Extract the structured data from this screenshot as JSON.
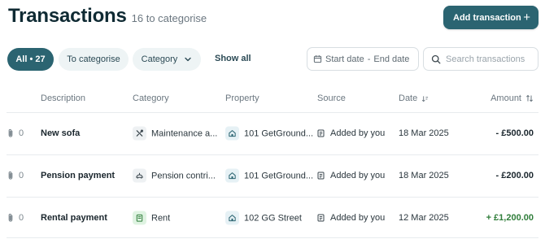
{
  "header": {
    "title": "Transactions",
    "subtitle": "16 to categorise",
    "add_button": "Add transaction"
  },
  "filters": {
    "all": "All • 27",
    "to_categorise": "To categorise",
    "category": "Category",
    "show_all": "Show all",
    "date_start": "Start date",
    "date_end": "End date",
    "search_placeholder": "Search transactions"
  },
  "columns": {
    "description": "Description",
    "category": "Category",
    "property": "Property",
    "source": "Source",
    "date": "Date",
    "amount": "Amount"
  },
  "rows": [
    {
      "attachments": "0",
      "description": "New sofa",
      "category": "Maintenance a...",
      "category_icon": "tools-icon",
      "property": "101 GetGround...",
      "source": "Added by you",
      "date": "18 Mar 2025",
      "amount": "- £500.00"
    },
    {
      "attachments": "0",
      "description": "Pension payment",
      "category": "Pension contri...",
      "category_icon": "piggy-bank-icon",
      "property": "101 GetGround...",
      "source": "Added by you",
      "date": "18 Mar 2025",
      "amount": "- £200.00"
    },
    {
      "attachments": "0",
      "description": "Rental payment",
      "category": "Rent",
      "category_icon": "rent-icon",
      "property": "102 GG Street",
      "source": "Added by you",
      "date": "12 Mar 2025",
      "amount": "+ £1,200.00"
    }
  ],
  "colors": {
    "primary": "#2b6471",
    "positive_amount": "#2f7d3a"
  }
}
